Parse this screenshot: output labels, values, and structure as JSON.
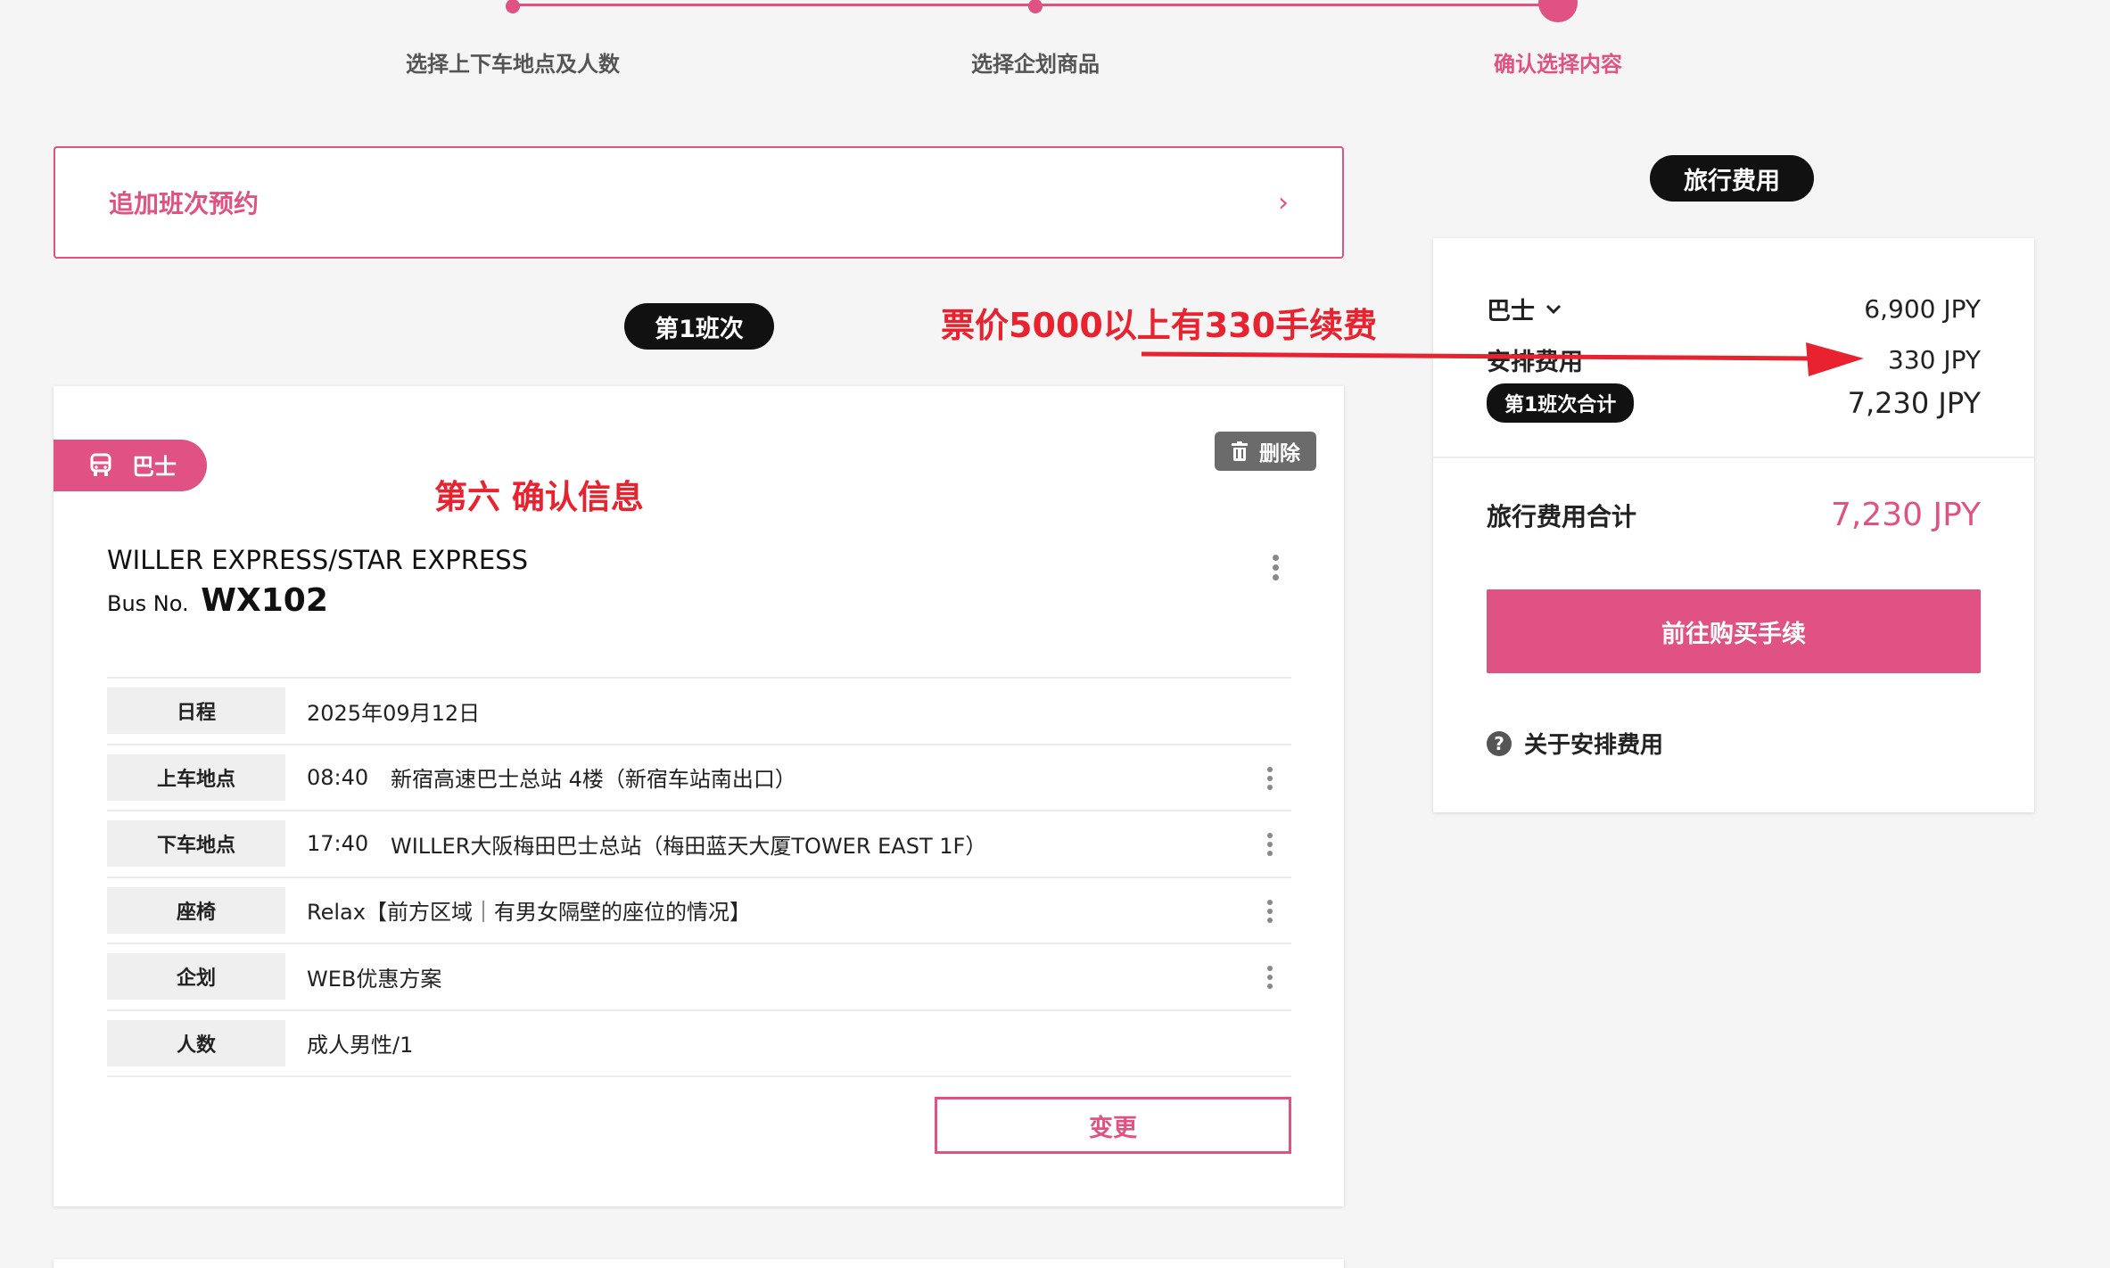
{
  "stepper": {
    "steps": [
      {
        "label": "选择上下车地点及人数"
      },
      {
        "label": "选择企划商品"
      },
      {
        "label": "确认选择内容"
      }
    ]
  },
  "add_reservation": {
    "label": "追加班次预约"
  },
  "trip": {
    "pill": "第1班次",
    "tag": "巴士",
    "delete_label": "删除",
    "operator": "WILLER EXPRESS/STAR EXPRESS",
    "bus_no_prefix": "Bus No.",
    "bus_no": "WX102",
    "rows": [
      {
        "label": "日程",
        "time": "",
        "value": "2025年09月12日"
      },
      {
        "label": "上车地点",
        "time": "08:40",
        "value": "新宿高速巴士总站 4楼（新宿车站南出口）"
      },
      {
        "label": "下车地点",
        "time": "17:40",
        "value": "WILLER大阪梅田巴士总站（梅田蓝天大厦TOWER EAST 1F）"
      },
      {
        "label": "座椅",
        "time": "",
        "value": "Relax【前方区域｜有男女隔壁的座位的情况】"
      },
      {
        "label": "企划",
        "time": "",
        "value": "WEB优惠方案"
      },
      {
        "label": "人数",
        "time": "",
        "value": "成人男性/1"
      }
    ],
    "change_label": "变更"
  },
  "cost": {
    "pill": "旅行费用",
    "bus_label": "巴士",
    "bus_value": "6,900 JPY",
    "fee_label": "安排费用",
    "fee_value": "330 JPY",
    "subtotal_label": "第1班次合计",
    "subtotal_value": "7,230 JPY",
    "total_label": "旅行费用合计",
    "total_value": "7,230 JPY",
    "proceed_label": "前往购买手续",
    "help_label": "关于安排费用",
    "help_icon_glyph": "?"
  },
  "annotations": {
    "fee_note": "票价5000以上有330手续费",
    "step_note": "第六 确认信息"
  },
  "colors": {
    "accent": "#e05283",
    "annotation": "#e8232f"
  }
}
